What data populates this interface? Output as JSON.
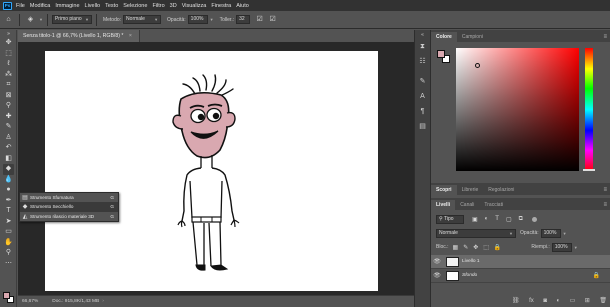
{
  "app": {
    "logo": "Ps"
  },
  "menu": [
    "File",
    "Modifica",
    "Immagine",
    "Livello",
    "Testo",
    "Selezione",
    "Filtro",
    "3D",
    "Visualizza",
    "Finestra",
    "Aiuto"
  ],
  "options": {
    "source_value": "Primo piano",
    "method_label": "Metodo:",
    "method_value": "Normale",
    "opacity_label": "Opacità:",
    "opacity_value": "100%",
    "tolerance_label": "Toller.:",
    "tolerance_value": "32"
  },
  "document": {
    "tab_title": "Senza titolo-1 @ 66,7% (Livello 1, RGB/8) *",
    "zoom": "66,67%",
    "doc_info": "Doc.: 915,8K/1,43 MB"
  },
  "flyout": [
    {
      "name": "Strumento Sfumatura",
      "shortcut": "G"
    },
    {
      "name": "Strumento Secchiello",
      "shortcut": "G"
    },
    {
      "name": "Strumento rilascio materiale 3D",
      "shortcut": "G"
    }
  ],
  "color_panel": {
    "tabs": [
      "Colore",
      "Campioni"
    ],
    "foreground": "#d9a8b0",
    "background": "#ffffff"
  },
  "lower_tabs": [
    "Scopri",
    "Librerie",
    "Regolazioni"
  ],
  "layers_panel": {
    "tabs": [
      "Livelli",
      "Canali",
      "Tracciati"
    ],
    "filter_kind": "Tipo",
    "blend_mode": "Normale",
    "opacity_label": "Opacità:",
    "opacity_value": "100%",
    "lock_label": "Bloc.:",
    "fill_label": "Riempi.:",
    "fill_value": "100%",
    "layers": [
      {
        "name": "Livello 1",
        "selected": true,
        "locked": false
      },
      {
        "name": "Sfondo",
        "selected": false,
        "locked": true
      }
    ]
  },
  "colors": {
    "skin": "#d9a8b0",
    "ui_bg": "#535353",
    "canvas": "#ffffff"
  }
}
